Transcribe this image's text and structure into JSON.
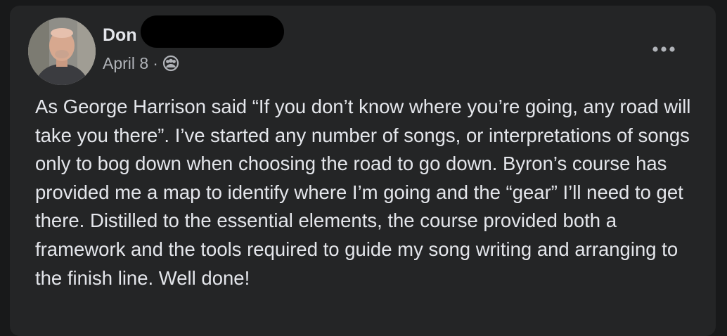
{
  "post": {
    "author": {
      "name_visible": "Don",
      "name_redacted": true
    },
    "date": "April 8",
    "separator": "·",
    "audience_icon": "friends-icon",
    "more_icon": "more-options-icon",
    "text": "As George Harrison said “If you don’t know where you’re going, any road will take you there”. I’ve started any number of songs, or interpretations of songs only to bog down when choosing the road to go down. Byron’s course has provided me a map to identify where I’m going and the “gear” I’ll need to get there. Distilled to the essential elements, the course provided both a framework and the tools required to guide my song writing and arranging to the finish line. Well done!"
  },
  "colors": {
    "page_bg": "#18191a",
    "card_bg": "#242526",
    "primary_text": "#e4e6eb",
    "secondary_text": "#b0b3b8"
  }
}
